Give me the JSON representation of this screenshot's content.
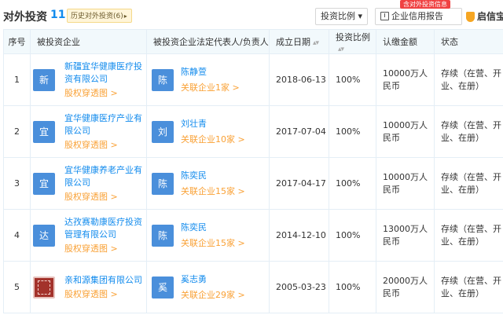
{
  "header": {
    "title": "对外投资",
    "count": "11",
    "history_tag": "历史对外投资(6)",
    "ratio_button": "投资比例",
    "report_tip": "含对外投资信息",
    "report_button": "企业信用报告",
    "brand": "启信宝"
  },
  "columns": {
    "index": "序号",
    "company": "被投资企业",
    "rep": "被投资企业法定代表人/负责人",
    "date": "成立日期",
    "ratio": "投资比例",
    "capital": "认缴金额",
    "status": "状态"
  },
  "colors": {
    "accent": "#128bed",
    "link_orange": "#f9a136",
    "badge_red": "#f04142"
  },
  "rows": [
    {
      "index": "1",
      "logo_text": "新",
      "logo_color": "#4a8fdb",
      "company": "新疆宜华健康医疗投资有限公司",
      "equity_link": "股权穿透图 >",
      "rep_initial": "陈",
      "rep_color": "#4a8fdb",
      "rep_name": "陈静萱",
      "rep_related": "关联企业1家 >",
      "date": "2018-06-13",
      "ratio": "100%",
      "capital": "10000万人民币",
      "status": "存续（在营、开业、在册）"
    },
    {
      "index": "2",
      "logo_text": "宜",
      "logo_color": "#4a8fdb",
      "company": "宜华健康医疗产业有限公司",
      "equity_link": "股权穿透图 >",
      "rep_initial": "刘",
      "rep_color": "#4a8fdb",
      "rep_name": "刘壮青",
      "rep_related": "关联企业10家 >",
      "date": "2017-07-04",
      "ratio": "100%",
      "capital": "10000万人民币",
      "status": "存续（在营、开业、在册）"
    },
    {
      "index": "3",
      "logo_text": "宜",
      "logo_color": "#4a8fdb",
      "company": "宜华健康养老产业有限公司",
      "equity_link": "股权穿透图 >",
      "rep_initial": "陈",
      "rep_color": "#4a8fdb",
      "rep_name": "陈奕民",
      "rep_related": "关联企业15家 >",
      "date": "2017-04-17",
      "ratio": "100%",
      "capital": "10000万人民币",
      "status": "存续（在营、开业、在册）"
    },
    {
      "index": "4",
      "logo_text": "达",
      "logo_color": "#4a8fdb",
      "company": "达孜赛勒康医疗投资管理有限公司",
      "equity_link": "股权穿透图 >",
      "rep_initial": "陈",
      "rep_color": "#4a8fdb",
      "rep_name": "陈奕民",
      "rep_related": "关联企业15家 >",
      "date": "2014-12-10",
      "ratio": "100%",
      "capital": "13000万人民币",
      "status": "存续（在营、开业、在册）"
    },
    {
      "index": "5",
      "logo_text": "",
      "logo_color": "#a3322b",
      "company": "亲和源集团有限公司",
      "equity_link": "股权穿透图 >",
      "rep_initial": "奚",
      "rep_color": "#4a8fdb",
      "rep_name": "奚志勇",
      "rep_related": "关联企业29家 >",
      "date": "2005-03-23",
      "ratio": "100%",
      "capital": "20000万人民币",
      "status": "存续（在营、开业、在册）"
    }
  ]
}
